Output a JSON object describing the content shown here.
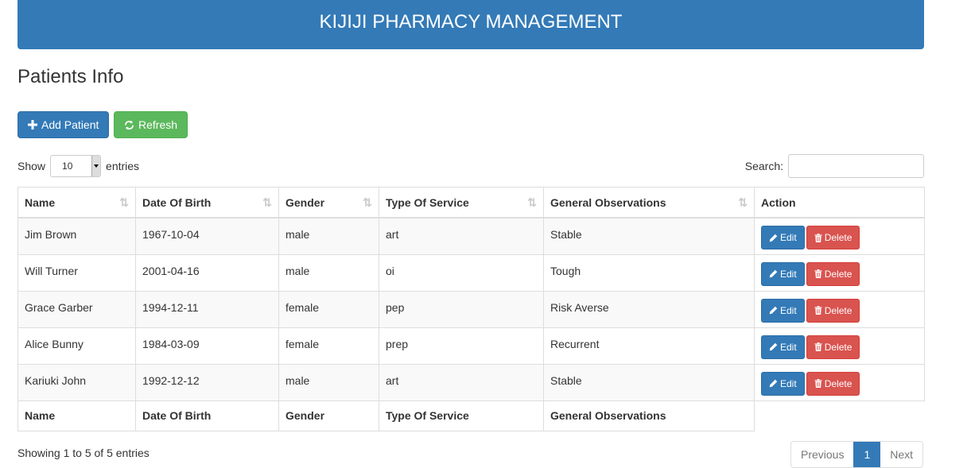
{
  "header": {
    "title": "KIJIJI PHARMACY MANAGEMENT"
  },
  "page": {
    "title": "Patients Info"
  },
  "toolbar": {
    "add_label": "Add Patient",
    "refresh_label": "Refresh"
  },
  "length": {
    "show_label": "Show",
    "value": "10",
    "entries_label": "entries"
  },
  "search": {
    "label": "Search:",
    "value": ""
  },
  "table": {
    "columns": [
      "Name",
      "Date Of Birth",
      "Gender",
      "Type Of Service",
      "General Observations",
      "Action"
    ],
    "footer_columns": [
      "Name",
      "Date Of Birth",
      "Gender",
      "Type Of Service",
      "General Observations"
    ],
    "rows": [
      {
        "name": "Jim Brown",
        "dob": "1967-10-04",
        "gender": "male",
        "service": "art",
        "observations": "Stable"
      },
      {
        "name": "Will Turner",
        "dob": "2001-04-16",
        "gender": "male",
        "service": "oi",
        "observations": "Tough"
      },
      {
        "name": "Grace Garber",
        "dob": "1994-12-11",
        "gender": "female",
        "service": "pep",
        "observations": "Risk Averse"
      },
      {
        "name": "Alice Bunny",
        "dob": "1984-03-09",
        "gender": "female",
        "service": "prep",
        "observations": "Recurrent"
      },
      {
        "name": "Kariuki John",
        "dob": "1992-12-12",
        "gender": "male",
        "service": "art",
        "observations": "Stable"
      }
    ],
    "edit_label": "Edit",
    "delete_label": "Delete"
  },
  "footer": {
    "info": "Showing 1 to 5 of 5 entries",
    "previous": "Previous",
    "current_page": "1",
    "next": "Next"
  },
  "colors": {
    "primary": "#337ab7",
    "success": "#5cb85c",
    "danger": "#d9534f"
  },
  "icons": {
    "add": "plus-icon",
    "refresh": "refresh-icon",
    "edit": "pencil-icon",
    "delete": "trash-icon",
    "sort": "sort-icon"
  }
}
